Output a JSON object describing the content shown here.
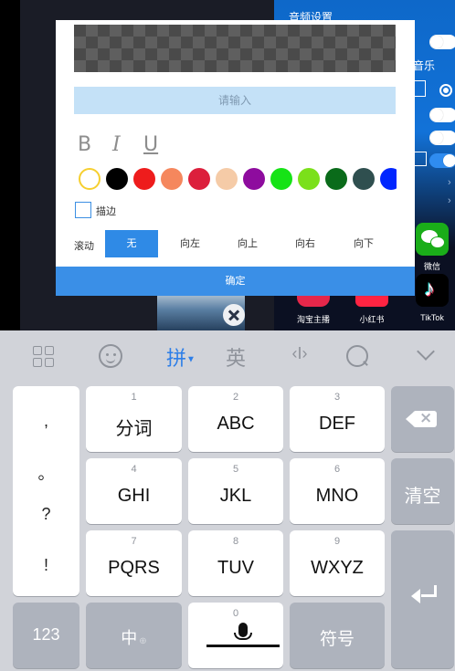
{
  "background_app": {
    "audio_settings_title": "音频设置",
    "music_label": "音乐",
    "share": {
      "wechat": "微信",
      "tiktok": "TikTok",
      "taobao": "淘宝主播",
      "xiaohongshu": "小红书"
    }
  },
  "dialog": {
    "input_placeholder": "请输入",
    "format": {
      "bold": "B",
      "italic": "I",
      "underline": "U"
    },
    "colors": [
      "#ffffff",
      "#000000",
      "#ee1c1c",
      "#f5875d",
      "#dc1f3c",
      "#f5cba7",
      "#8e0c9e",
      "#16e316",
      "#7be01a",
      "#0a6b1a",
      "#2f4f4f",
      "#0026ff"
    ],
    "stroke_label": "描边",
    "scroll": {
      "label": "滚动",
      "options": [
        "无",
        "向左",
        "向上",
        "向右",
        "向下"
      ],
      "selected": "无"
    },
    "confirm": "确定"
  },
  "keyboard": {
    "toolbar": {
      "pinyin": "拼",
      "english": "英",
      "cursor": "‹I›"
    },
    "punct": [
      ",",
      "。",
      "?",
      "!"
    ],
    "keys": [
      {
        "num": "1",
        "label": "分词"
      },
      {
        "num": "2",
        "label": "ABC"
      },
      {
        "num": "3",
        "label": "DEF"
      },
      {
        "num": "4",
        "label": "GHI"
      },
      {
        "num": "5",
        "label": "JKL"
      },
      {
        "num": "6",
        "label": "MNO"
      },
      {
        "num": "7",
        "label": "PQRS"
      },
      {
        "num": "8",
        "label": "TUV"
      },
      {
        "num": "9",
        "label": "WXYZ"
      }
    ],
    "clear": "清空",
    "num_switch": "123",
    "lang_switch": "中",
    "space_num": "0",
    "symbols": "符号"
  }
}
